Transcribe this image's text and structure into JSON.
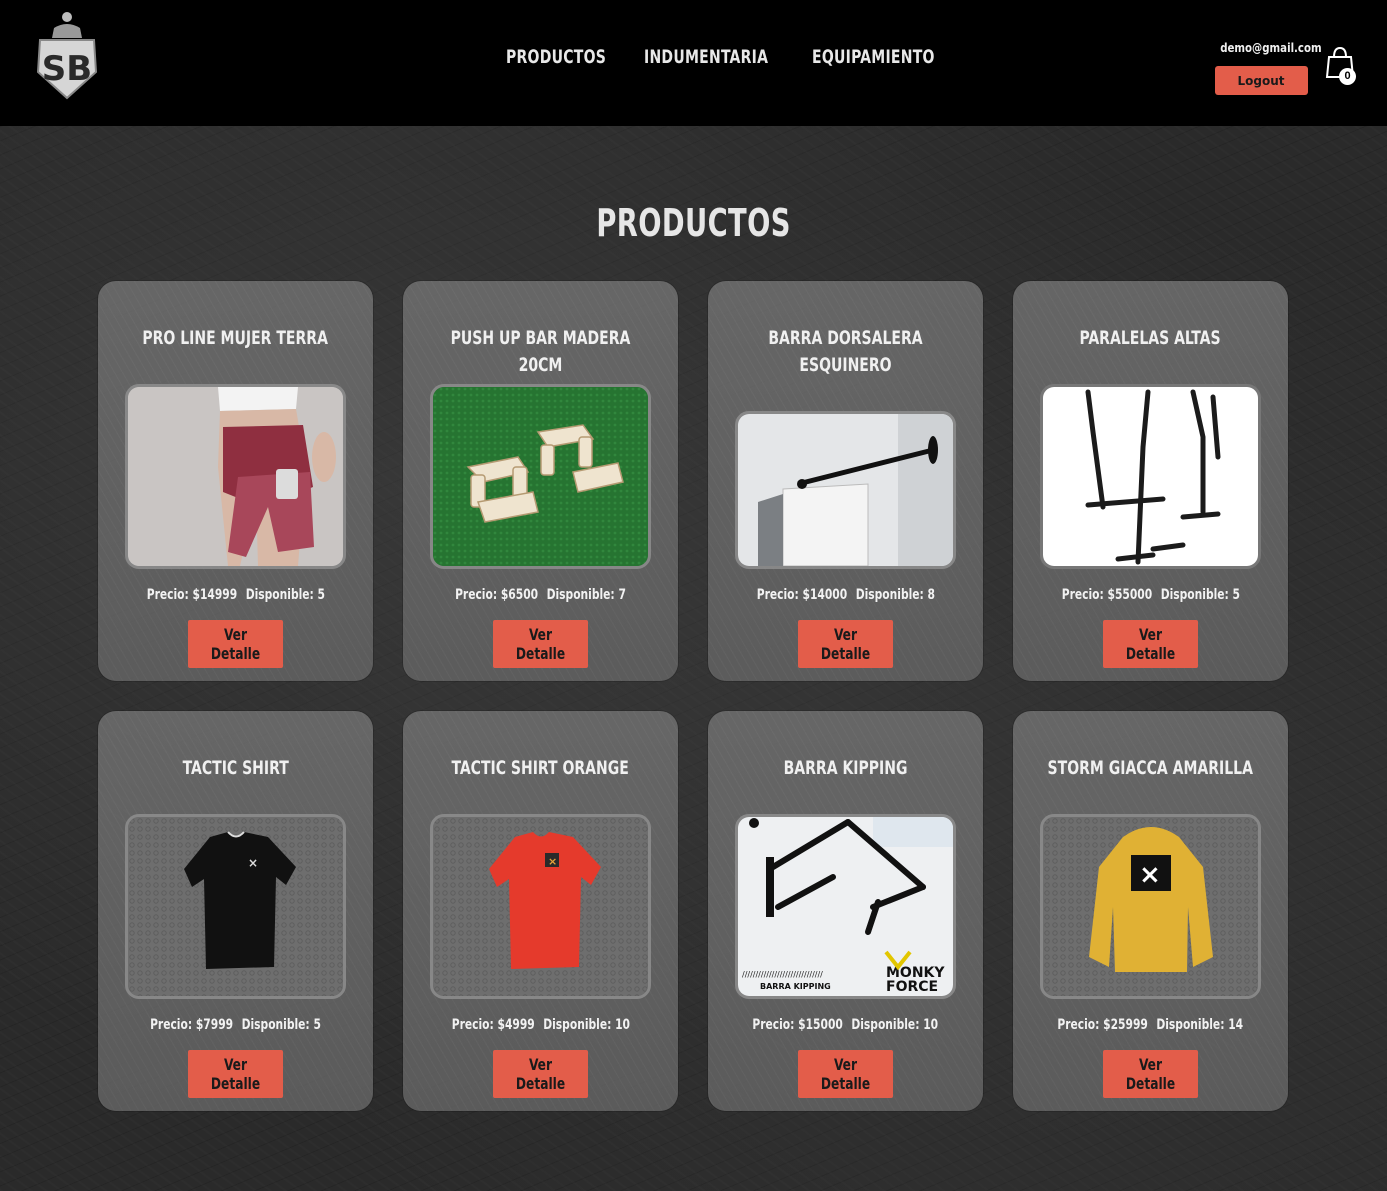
{
  "header": {
    "logo_text": "SB",
    "nav": [
      "PRODUCTOS",
      "INDUMENTARIA",
      "EQUIPAMIENTO"
    ],
    "user_email": "demo@gmail.com",
    "logout_label": "Logout",
    "cart_count": "0"
  },
  "page_title": "PRODUCTOS",
  "labels": {
    "price_prefix": "Precio: $",
    "stock_prefix": "Disponible: ",
    "detail_button": "Ver Detalle"
  },
  "colors": {
    "accent": "#e35d4a",
    "header_bg": "#000000",
    "card_bg": "#6b6b6b"
  },
  "products": [
    {
      "title": "PRO LINE MUJER TERRA",
      "price": "14999",
      "stock": "5",
      "image": "woman-shorts-photo"
    },
    {
      "title": "PUSH UP BAR MADERA 20CM",
      "price": "6500",
      "stock": "7",
      "image": "wooden-pushup-bars-photo"
    },
    {
      "title": "BARRA DORSALERA ESQUINERO",
      "price": "14000",
      "stock": "8",
      "image": "corner-pullup-bar-photo"
    },
    {
      "title": "PARALELAS ALTAS",
      "price": "55000",
      "stock": "5",
      "image": "parallel-bars-photo"
    },
    {
      "title": "TACTIC SHIRT",
      "price": "7999",
      "stock": "5",
      "image": "black-shirt-photo"
    },
    {
      "title": "TACTIC SHIRT ORANGE",
      "price": "4999",
      "stock": "10",
      "image": "orange-shirt-photo"
    },
    {
      "title": "BARRA KIPPING",
      "price": "15000",
      "stock": "10",
      "image": "kipping-bar-photo",
      "image_text": [
        "BARRA KIPPING",
        "MONKY",
        "FORCE"
      ]
    },
    {
      "title": "STORM GIACCA AMARILLA",
      "price": "25999",
      "stock": "14",
      "image": "yellow-hoodie-photo"
    }
  ]
}
